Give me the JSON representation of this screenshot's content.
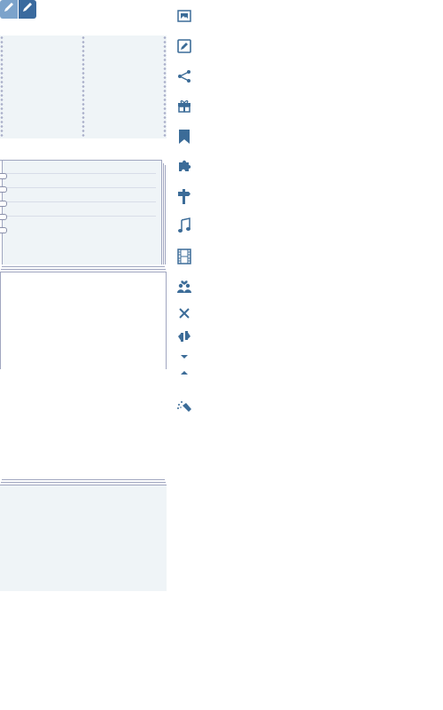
{
  "toolbar": {
    "buttons": [
      {
        "name": "pencil-light",
        "icon": "pencil-icon",
        "state": "inactive"
      },
      {
        "name": "pencil-dark",
        "icon": "pencil-icon",
        "state": "active"
      }
    ]
  },
  "colors": {
    "icon": "#3c6c98",
    "paper": "#eff4f7",
    "paper_edge": "#a0a6c0",
    "button_light": "#7ca3cb",
    "button_dark": "#3a6a9e"
  },
  "icons": [
    "picture-icon",
    "edit-icon",
    "share-icon",
    "gift-icon",
    "bookmark-icon",
    "puzzle-icon",
    "signpost-icon",
    "music-icon",
    "film-icon",
    "couple-icon",
    "close-icon",
    "swap-icon",
    "triangle-down-icon",
    "triangle-up-icon",
    "magic-wand-icon"
  ]
}
